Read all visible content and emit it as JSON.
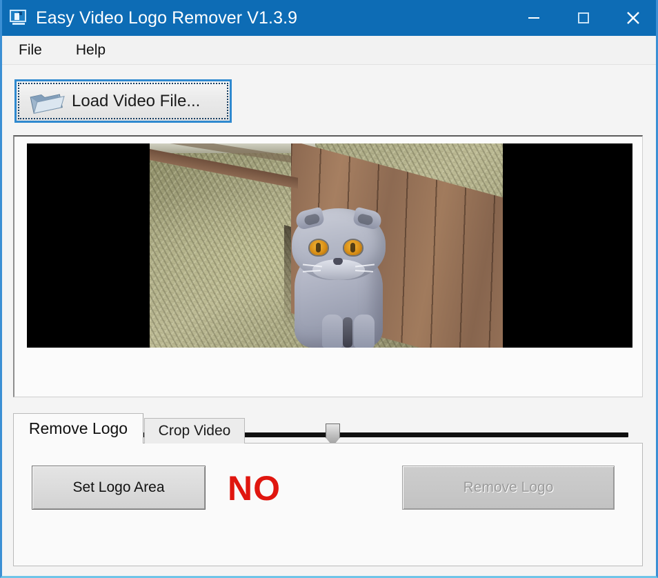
{
  "window": {
    "title": "Easy Video Logo Remover V1.3.9",
    "icon": "app-monitor-icon",
    "titlebar_color": "#0d6cb5",
    "controls": {
      "minimize": "minimize-icon",
      "maximize": "maximize-icon",
      "close": "close-icon"
    }
  },
  "menu": {
    "items": [
      {
        "label": "File"
      },
      {
        "label": "Help"
      }
    ]
  },
  "toolbar": {
    "load_button": {
      "label": "Load Video File...",
      "icon": "folder-icon",
      "focused": true
    }
  },
  "preview": {
    "description": "Video preview frame: gray-blue Scottish Fold cat standing on a grassy dirt path beside a brown wooden fence, pillarboxed with black bars",
    "letterbox_color": "#000000"
  },
  "slider": {
    "name": "video-position-slider",
    "value_percent": 49,
    "tick_count": 51
  },
  "tabs": [
    {
      "label": "Remove Logo",
      "active": true
    },
    {
      "label": "Crop Video",
      "active": false
    }
  ],
  "remove_logo_tab": {
    "set_logo_area_label": "Set Logo Area",
    "status_flag": "NO",
    "status_color": "#e0160f",
    "remove_logo_label": "Remove Logo",
    "remove_logo_disabled": true
  }
}
